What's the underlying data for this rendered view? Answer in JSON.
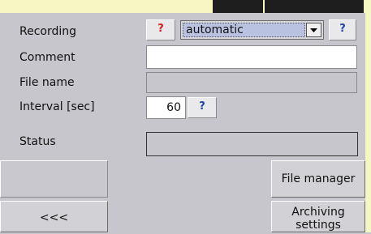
{
  "form": {
    "recording_label": "Recording",
    "comment_label": "Comment",
    "file_name_label": "File name",
    "interval_label": "Interval [sec]",
    "status_label": "Status",
    "help_glyph": "?",
    "recording_value": "automatic",
    "comment_value": "",
    "file_name_value": "",
    "interval_value": "60",
    "status_value": ""
  },
  "buttons": {
    "back_label": "<<<",
    "file_manager_label": "File manager",
    "archiving_label_line1": "Archiving",
    "archiving_label_line2": "settings"
  },
  "colors": {
    "background": "#c6c6cc",
    "top_accent": "#f7f7c4",
    "help_red": "#e01818",
    "help_blue": "#2440a8"
  }
}
